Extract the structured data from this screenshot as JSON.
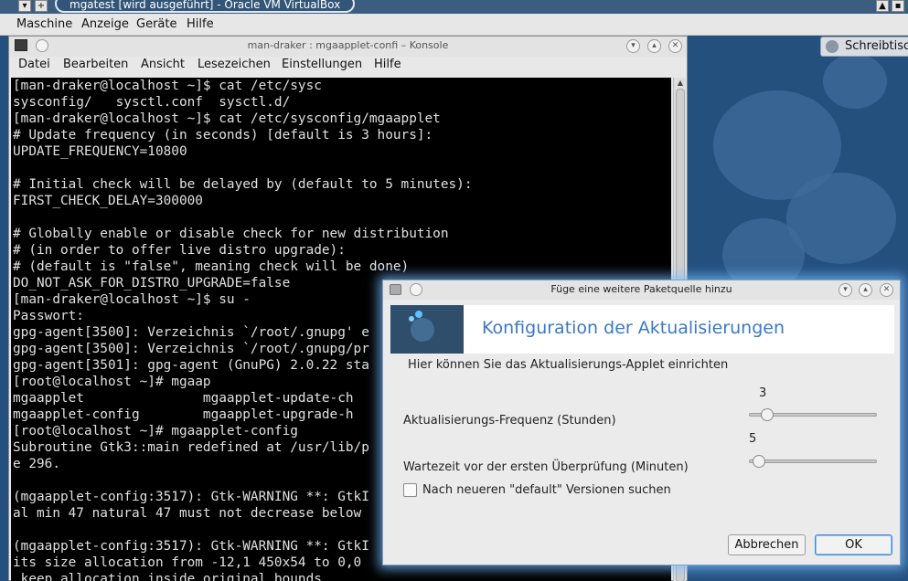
{
  "vbox": {
    "title": "mgatest [wird ausgeführt] - Oracle VM VirtualBox",
    "menu": [
      "Maschine",
      "Anzeige",
      "Geräte",
      "Hilfe"
    ]
  },
  "desktop": {
    "tab_label": "Schreibtisch"
  },
  "konsole": {
    "title": "man-draker : mgaapplet-confi – Konsole",
    "menu": [
      "Datei",
      "Bearbeiten",
      "Ansicht",
      "Lesezeichen",
      "Einstellungen",
      "Hilfe"
    ],
    "lines": [
      "[man-draker@localhost ~]$ cat /etc/sysc",
      "sysconfig/   sysctl.conf  sysctl.d/",
      "[man-draker@localhost ~]$ cat /etc/sysconfig/mgaapplet",
      "# Update frequency (in seconds) [default is 3 hours]:",
      "UPDATE_FREQUENCY=10800",
      "",
      "# Initial check will be delayed by (default to 5 minutes):",
      "FIRST_CHECK_DELAY=300000",
      "",
      "# Globally enable or disable check for new distribution",
      "# (in order to offer live distro upgrade):",
      "# (default is \"false\", meaning check will be done)",
      "DO_NOT_ASK_FOR_DISTRO_UPGRADE=false",
      "[man-draker@localhost ~]$ su -",
      "Passwort:",
      "gpg-agent[3500]: Verzeichnis `/root/.gnupg' e",
      "gpg-agent[3500]: Verzeichnis `/root/.gnupg/pr",
      "gpg-agent[3501]: gpg-agent (GnuPG) 2.0.22 sta",
      "[root@localhost ~]# mgaap",
      "mgaapplet               mgaapplet-update-ch",
      "mgaapplet-config        mgaapplet-upgrade-h",
      "[root@localhost ~]# mgaapplet-config",
      "Subroutine Gtk3::main redefined at /usr/lib/p",
      "e 296.",
      "",
      "(mgaapplet-config:3517): Gtk-WARNING **: GtkI",
      "al min 47 natural 47 must not decrease below",
      "",
      "(mgaapplet-config:3517): Gtk-WARNING **: GtkI",
      "its size allocation from -12,1 450x54 to 0,0",
      " keep allocation inside original bounds"
    ]
  },
  "dialog": {
    "title": "Füge eine weitere Paketquelle hinzu",
    "heading": "Konfiguration der Aktualisierungen",
    "intro": "Hier können Sie das Aktualisierungs-Applet einrichten",
    "frequency": {
      "label": "Aktualisierungs-Frequenz (Stunden)",
      "value": "3",
      "fraction": 0.1
    },
    "delay": {
      "label": "Wartezeit vor der ersten Überprüfung (Minuten)",
      "value": "5",
      "fraction": 0.03
    },
    "checkbox_label": "Nach neueren \"default\" Versionen suchen",
    "cancel_label": "Abbrechen",
    "ok_label": "OK"
  }
}
